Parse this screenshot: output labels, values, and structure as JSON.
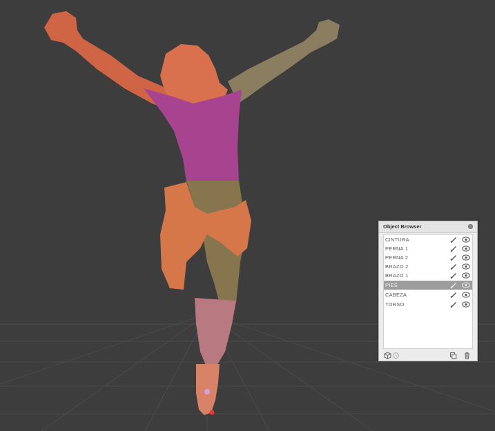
{
  "object_browser": {
    "title": "Object Browser",
    "objects": [
      {
        "label": "CINTURA",
        "selected": false
      },
      {
        "label": "PERNA 1",
        "selected": false
      },
      {
        "label": "PERNA 2",
        "selected": false
      },
      {
        "label": "BRAZO 2",
        "selected": false
      },
      {
        "label": "BRAZO 1",
        "selected": false
      },
      {
        "label": "PIES",
        "selected": true
      },
      {
        "label": "CABEZA",
        "selected": false
      },
      {
        "label": "TORSO",
        "selected": false
      }
    ]
  },
  "colors": {
    "background": "#3d3d3d",
    "grid": "#4b4b4b",
    "head": "#d9714f",
    "torso": "#a8448f",
    "cloth": "#d57748",
    "legs": "#87754d",
    "shins": "#b87a80",
    "feet": "#d88368",
    "left_arm": "#cf6545",
    "right_arm": "#8b7d5f",
    "selection": "#9d9d9d"
  }
}
